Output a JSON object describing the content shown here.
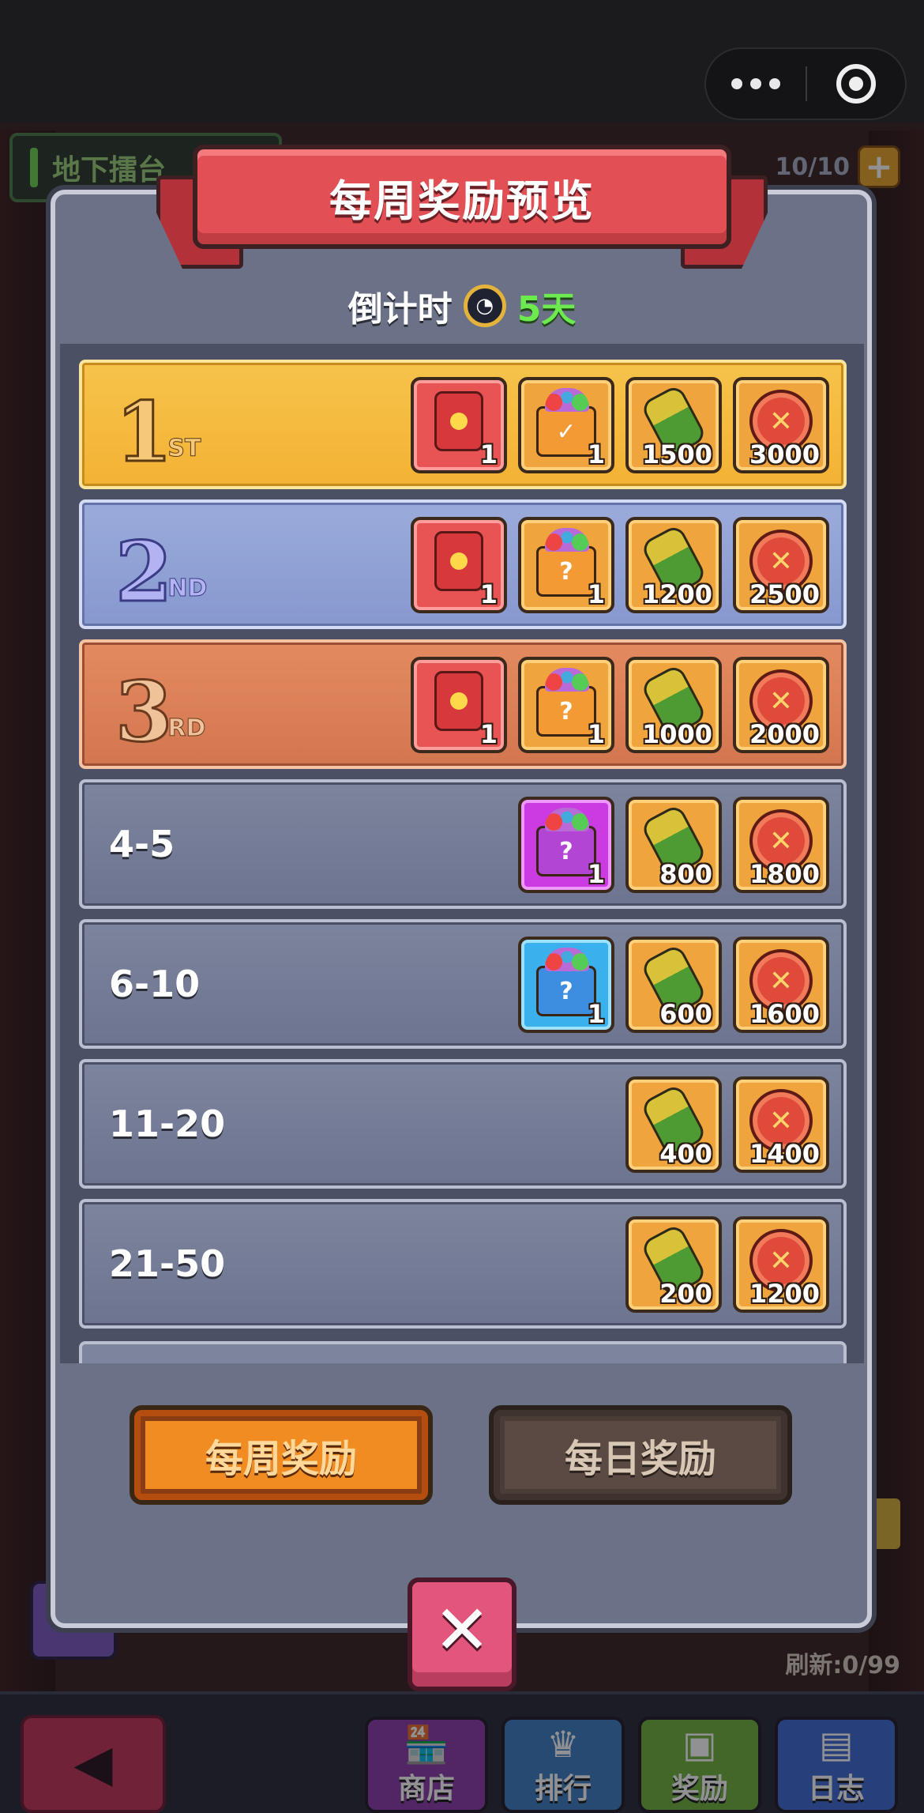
{
  "background": {
    "arena_label": "地下擂台",
    "energy": "10/10",
    "refresh": "刷新:0/99",
    "nav": [
      {
        "label": "商店",
        "icon": "shop-icon"
      },
      {
        "label": "排行",
        "icon": "rank-icon"
      },
      {
        "label": "奖励",
        "icon": "chest-icon"
      },
      {
        "label": "日志",
        "icon": "book-icon"
      }
    ]
  },
  "modal": {
    "title": "每周奖励预览",
    "countdown_label": "倒计时",
    "countdown_value": "5天",
    "rows": [
      {
        "rank": "1",
        "suffix": "ST",
        "items": [
          "1",
          "1",
          "1500",
          "3000"
        ]
      },
      {
        "rank": "2",
        "suffix": "ND",
        "items": [
          "1",
          "1",
          "1200",
          "2500"
        ]
      },
      {
        "rank": "3",
        "suffix": "RD",
        "items": [
          "1",
          "1",
          "1000",
          "2000"
        ]
      },
      {
        "label": "4-5",
        "items": [
          "1",
          "800",
          "1800"
        ]
      },
      {
        "label": "6-10",
        "items": [
          "1",
          "600",
          "1600"
        ]
      },
      {
        "label": "11-20",
        "items": [
          "400",
          "1400"
        ]
      },
      {
        "label": "21-50",
        "items": [
          "200",
          "1200"
        ]
      }
    ],
    "tabs": {
      "weekly": "每周奖励",
      "daily": "每日奖励"
    },
    "close": "✕"
  },
  "colors": {
    "gold": "#f3b234",
    "silver": "#8798cf",
    "bronze": "#d27650",
    "plain": "#6d7490",
    "accent_green": "#6cea4e",
    "title_red": "#e24f54"
  }
}
